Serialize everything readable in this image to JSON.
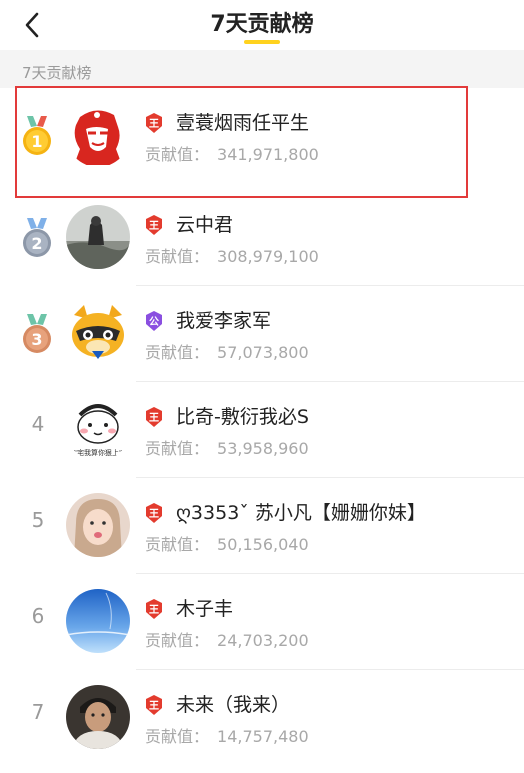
{
  "header": {
    "title": "7天贡献榜"
  },
  "section": {
    "label": "7天贡献榜"
  },
  "rows": [
    {
      "rank": "1",
      "medal": "gold",
      "level": "red",
      "level_char": "王",
      "name": "壹蓑烟雨任平生",
      "score_label": "贡献值：",
      "score": "341,971,800"
    },
    {
      "rank": "2",
      "medal": "silver",
      "level": "red",
      "level_char": "王",
      "name": "云中君",
      "score_label": "贡献值：",
      "score": "308,979,100"
    },
    {
      "rank": "3",
      "medal": "bronze",
      "level": "purple",
      "level_char": "公",
      "name": "我爱李家军",
      "score_label": "贡献值：",
      "score": "57,073,800"
    },
    {
      "rank": "4",
      "medal": "",
      "level": "red",
      "level_char": "王",
      "name": "比奇-敷衍我必S",
      "score_label": "贡献值：",
      "score": "53,958,960"
    },
    {
      "rank": "5",
      "medal": "",
      "level": "red",
      "level_char": "王",
      "name": "ღ3353ˇ 苏小凡【姗姗你妹】",
      "score_label": "贡献值：",
      "score": "50,156,040"
    },
    {
      "rank": "6",
      "medal": "",
      "level": "red",
      "level_char": "王",
      "name": "木子丰",
      "score_label": "贡献值：",
      "score": "24,703,200"
    },
    {
      "rank": "7",
      "medal": "",
      "level": "red",
      "level_char": "王",
      "name": "未来（我来）",
      "score_label": "贡献值：",
      "score": "14,757,480"
    }
  ],
  "avatar_extra": {
    "row4_caption": "\"宅我算你狠上\""
  },
  "colors": {
    "accent": "#ffd21e",
    "highlight": "#e23a3a",
    "level_red": "#e33b2e",
    "level_purple": "#8a4fe0"
  }
}
